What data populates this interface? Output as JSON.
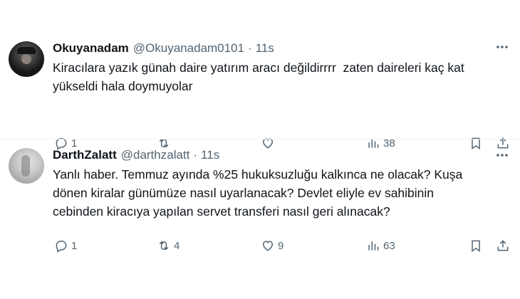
{
  "tweets": [
    {
      "name": "Okuyanadam",
      "handle": "@Okuyanadam0101",
      "dot": "·",
      "time": "11s",
      "text": "Kiracılara yazık günah daire yatırım aracı değildirrrr  zaten daireleri kaç kat\nyükseldi hala doymuyolar",
      "replies": "1",
      "retweets": "",
      "likes": "",
      "views": "38"
    },
    {
      "name": "DarthZalatt",
      "handle": "@darthzalatt",
      "dot": "·",
      "time": "11s",
      "text": "Yanlı haber. Temmuz ayında %25 hukuksuzluğu kalkınca ne olacak? Kuşa\ndönen kiralar günümüze nasıl uyarlanacak? Devlet eliyle ev sahibinin\ncebinden kiracıya yapılan servet transferi nasıl geri alınacak?",
      "replies": "1",
      "retweets": "4",
      "likes": "9",
      "views": "63"
    }
  ],
  "colors": {
    "text": "#0f1419",
    "muted": "#536471",
    "divider": "#eff3f4"
  }
}
